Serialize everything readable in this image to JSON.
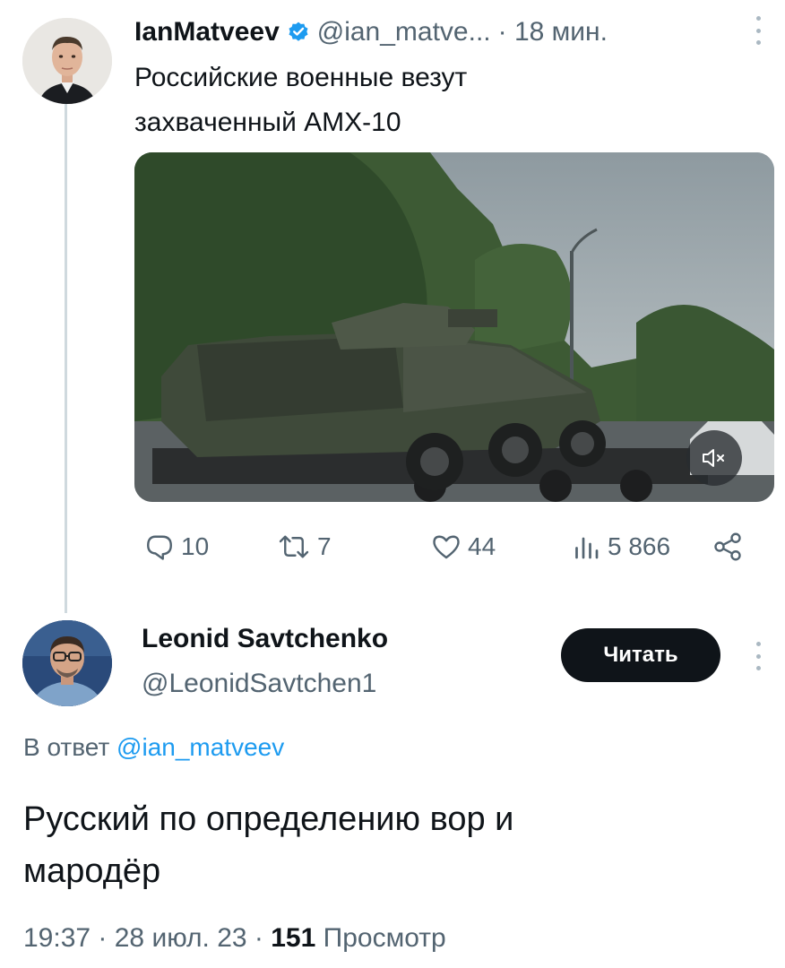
{
  "tweet1": {
    "author_name": "IanMatveev",
    "handle": "@ian_matve...",
    "time": "· 18 мин.",
    "text_line1": "Российские военные везут",
    "text_line2": "захваченный AMX-10",
    "stats": {
      "replies": "10",
      "retweets": "7",
      "likes": "44",
      "views": "5 866"
    }
  },
  "tweet2": {
    "author_name": "Leonid Savtchenko",
    "handle": "@LeonidSavtchen1",
    "follow_label": "Читать",
    "reply_prefix": "В ответ",
    "reply_handle": "@ian_matveev",
    "text_line1": "Русский по определению вор и",
    "text_line2": "мародёр",
    "time": "19:37 · 28 июл. 23 ·",
    "views_count": "151",
    "views_label": "Просмотр"
  },
  "colors": {
    "accent": "#1d9bf0",
    "secondary_text": "#536471",
    "primary_text": "#0f1419"
  },
  "icons": [
    "verified-badge-icon",
    "more-icon",
    "mute-icon",
    "reply-icon",
    "retweet-icon",
    "like-icon",
    "views-icon",
    "share-icon"
  ]
}
